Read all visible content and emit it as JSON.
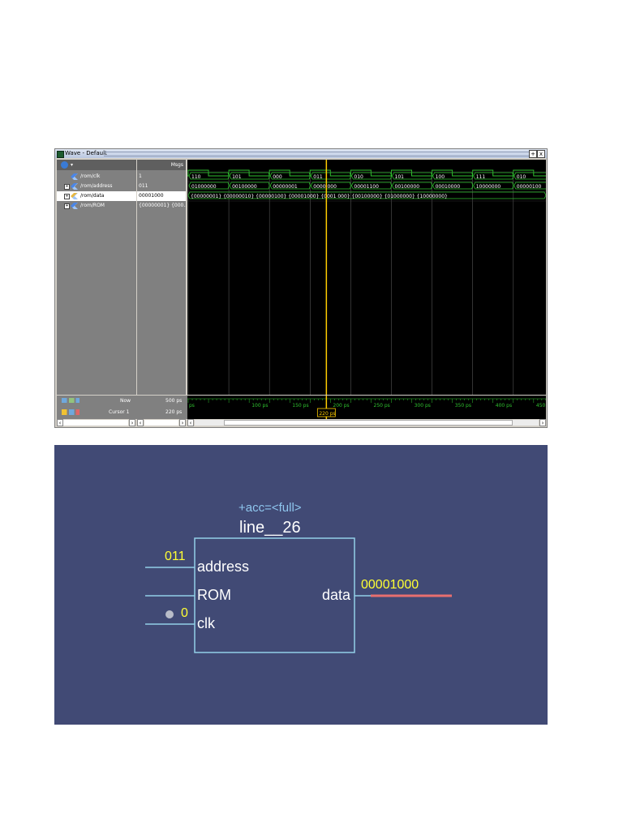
{
  "wave_window": {
    "title": "Wave - Default",
    "msgs_header": "Msgs",
    "max_button": "+",
    "close_button": "x",
    "signals": [
      {
        "name": "/rom/clk",
        "value": "1",
        "expandable": false,
        "selected": false
      },
      {
        "name": "/rom/address",
        "value": "011",
        "expandable": true,
        "selected": false
      },
      {
        "name": "/rom/data",
        "value": "00001000",
        "expandable": true,
        "selected": true
      },
      {
        "name": "/rom/ROM",
        "value": "{00000001} {000...",
        "expandable": true,
        "selected": false
      }
    ],
    "address_values": [
      "110",
      "101",
      "000",
      "011",
      "010",
      "101",
      "100",
      "111",
      "010"
    ],
    "data_values": [
      "01000000",
      "00100000",
      "00000001",
      "0000 000",
      "00001100",
      "00100000",
      "00010000",
      "10000000",
      "00000100"
    ],
    "rom_values": "{00000001} {00000010} {00000100} {00001000} {0001 000} {00100000} {01000000} {10000000}",
    "timeline_labels": [
      "ps",
      "100 ps",
      "150 ps",
      "200 ps",
      "250 ps",
      "300 ps",
      "350 ps",
      "400 ps",
      "450 ps"
    ],
    "now_label": "Now",
    "now_value": "500 ps",
    "cursor_label": "Cursor 1",
    "cursor_value": "220 ps",
    "cursor_marker": "220 ps",
    "colors": {
      "wave": "#2fc22f",
      "cursor": "#ffcc00",
      "background": "#000000"
    }
  },
  "schematic": {
    "attribute": "+acc=<full>",
    "instance_name": "line__26",
    "ports_in": [
      {
        "name": "address",
        "value": "011"
      },
      {
        "name": "ROM",
        "value": ""
      },
      {
        "name": "clk",
        "value": "0"
      }
    ],
    "port_out": {
      "name": "data",
      "value": "00001000"
    },
    "colors": {
      "background": "#414a75",
      "value": "#ffff33",
      "wire": "#93cfe8",
      "output_bus": "#e86f6f"
    }
  }
}
